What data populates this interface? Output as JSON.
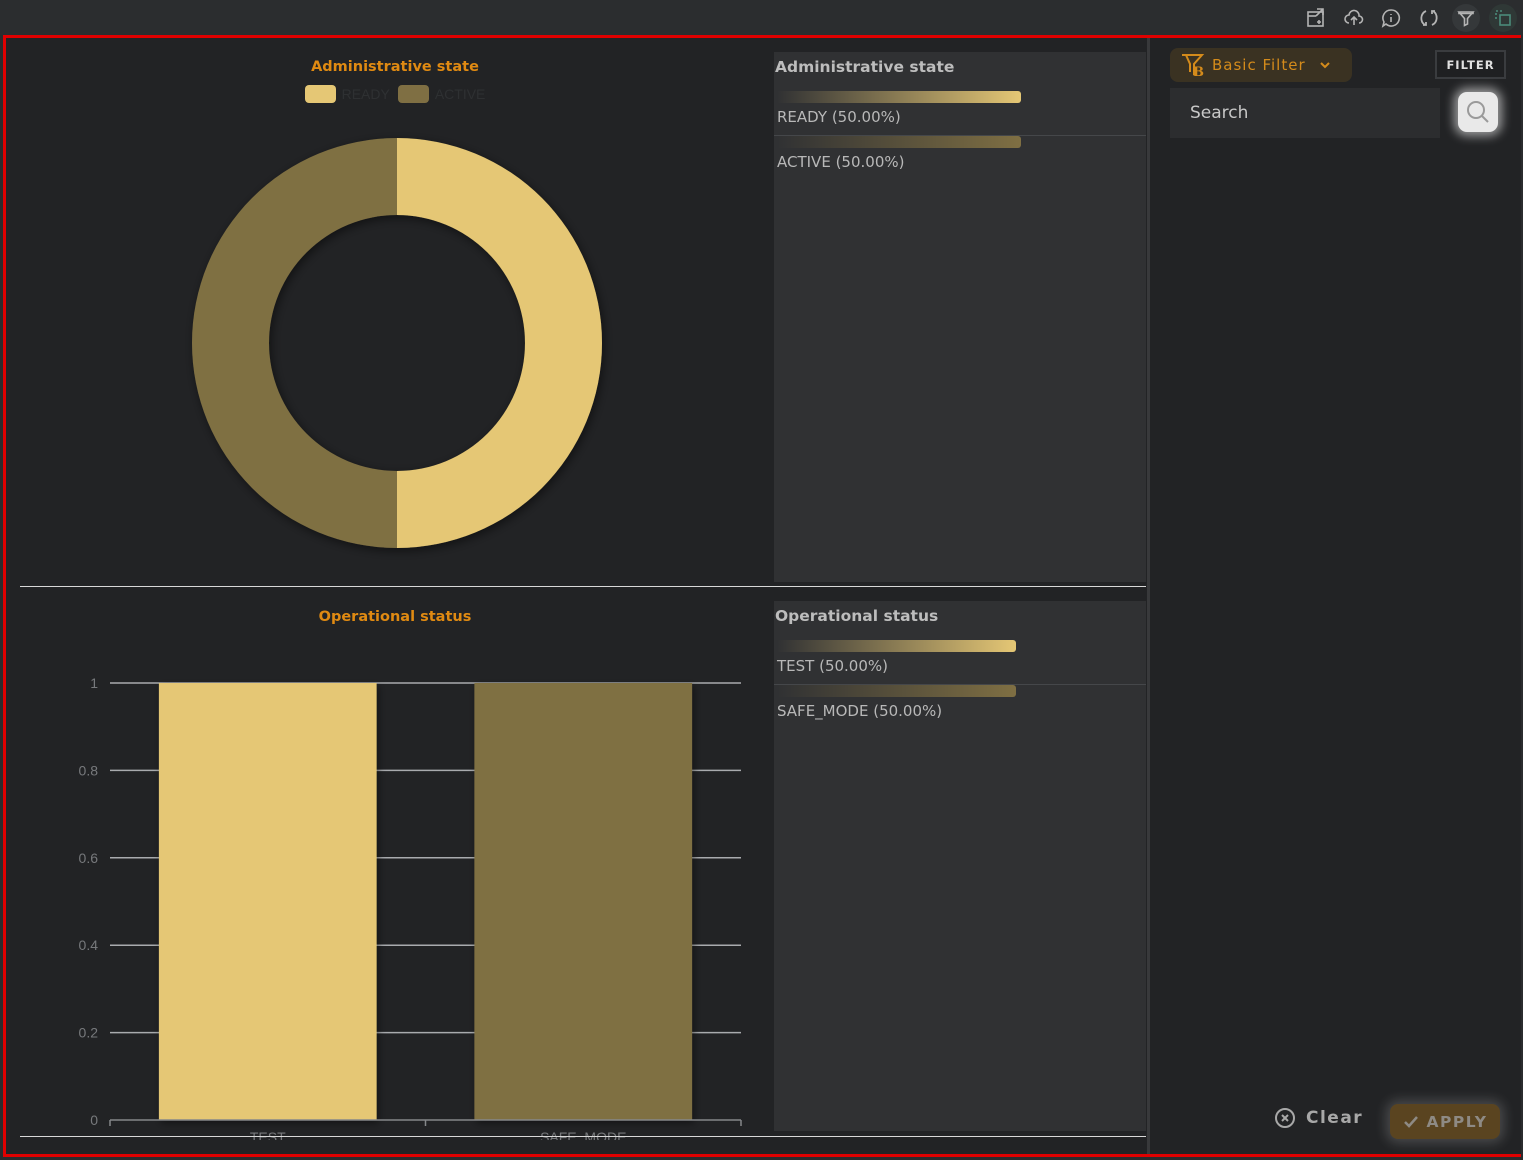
{
  "toolbar": {
    "icons": [
      "export-icon",
      "upload-cloud-icon",
      "info-icon",
      "refresh-icon",
      "filter-icon",
      "select-area-icon"
    ]
  },
  "colors": {
    "ready": "#e5c775",
    "active": "#7f6f43",
    "title_accent": "#e08a12",
    "frame_border": "#e00000"
  },
  "admin_state": {
    "stat_title": "Administrative state",
    "rows": [
      {
        "label": "READY (50.00%)",
        "percent": 50
      },
      {
        "label": "ACTIVE (50.00%)",
        "percent": 50
      }
    ]
  },
  "operational_status": {
    "stat_title": "Operational status",
    "rows": [
      {
        "label": "TEST (50.00%)",
        "percent": 50
      },
      {
        "label": "SAFE_MODE (50.00%)",
        "percent": 50
      }
    ]
  },
  "filter": {
    "mode_label": "Basic Filter",
    "filter_button": "FILTER",
    "search_placeholder": "Search",
    "clear_label": "Clear",
    "apply_label": "APPLY"
  },
  "chart_data": [
    {
      "type": "pie",
      "title": "Administrative state",
      "legend": [
        "READY",
        "ACTIVE"
      ],
      "legend_position": "top",
      "categories": [
        "READY",
        "ACTIVE"
      ],
      "values": [
        1,
        1
      ],
      "colors": [
        "#e5c775",
        "#7f6f43"
      ],
      "donut": true
    },
    {
      "type": "bar",
      "title": "Operational status",
      "categories": [
        "TEST",
        "SAFE_MODE"
      ],
      "values": [
        1,
        1
      ],
      "colors": [
        "#e5c775",
        "#7f6f43"
      ],
      "xlabel": "",
      "ylabel": "",
      "ylim": [
        0,
        1
      ],
      "yticks": [
        0,
        0.2,
        0.4,
        0.6,
        0.8,
        1
      ],
      "ytick_labels": [
        "0",
        "0.2",
        "0.4",
        "0.6",
        "0.8",
        "1"
      ],
      "grid": true
    }
  ]
}
